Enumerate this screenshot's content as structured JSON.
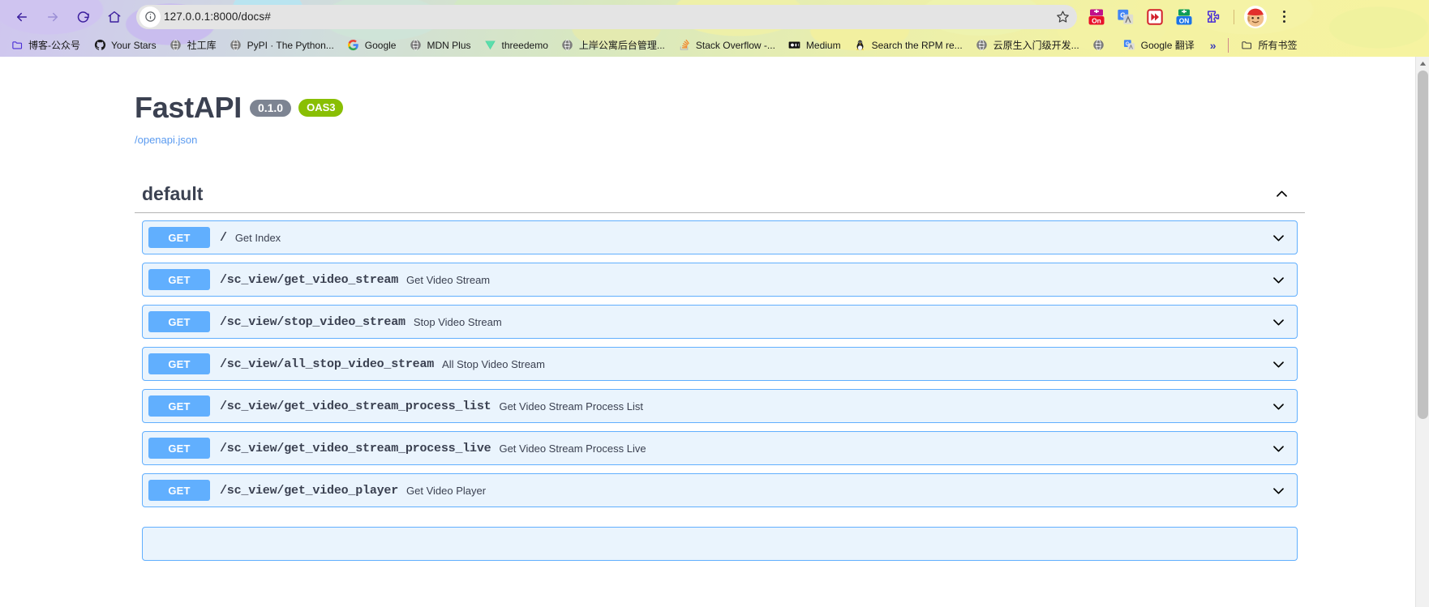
{
  "browser": {
    "nav": {
      "back_label": "Back",
      "forward_label": "Forward",
      "reload_label": "Reload",
      "home_label": "Home"
    },
    "omnibox": {
      "url": "127.0.0.1:8000/docs#",
      "info_icon": "site-info-icon",
      "bookmark_icon": "star-icon"
    },
    "extensions": [
      {
        "name": "adblock-on-extension",
        "label": "On"
      },
      {
        "name": "google-translate-extension",
        "label": "G"
      },
      {
        "name": "fast-forward-extension",
        "label": ""
      },
      {
        "name": "proxy-on-extension",
        "label": "ON"
      },
      {
        "name": "extensions-puzzle-icon",
        "label": ""
      }
    ],
    "profile": {
      "name": "profile-avatar"
    },
    "menu": {
      "name": "chrome-menu-kebab"
    },
    "bookmarks": [
      {
        "label": "博客-公众号",
        "icon": "folder-icon"
      },
      {
        "label": "Your Stars",
        "icon": "github-icon"
      },
      {
        "label": "社工库",
        "icon": "globe-icon"
      },
      {
        "label": "PyPI · The Python...",
        "icon": "globe-icon"
      },
      {
        "label": "Google",
        "icon": "google-icon"
      },
      {
        "label": "MDN Plus",
        "icon": "globe-icon"
      },
      {
        "label": "threedemo",
        "icon": "vite-icon"
      },
      {
        "label": "上岸公寓后台管理...",
        "icon": "globe-icon"
      },
      {
        "label": "Stack Overflow -...",
        "icon": "stackoverflow-icon"
      },
      {
        "label": "Medium",
        "icon": "medium-icon"
      },
      {
        "label": "Search the RPM re...",
        "icon": "linux-tux-icon"
      },
      {
        "label": "云原生入门级开发...",
        "icon": "globe-icon"
      },
      {
        "label": "Google 翻译",
        "icon": "google-translate-icon"
      }
    ],
    "bookmarks_overflow": "»",
    "all_bookmarks": {
      "label": "所有书签",
      "icon": "folder-icon"
    }
  },
  "swagger": {
    "title": "FastAPI",
    "version_badge": "0.1.0",
    "oas_badge": "OAS3",
    "spec_link": "/openapi.json",
    "tag": {
      "name": "default",
      "collapse_icon": "chevron-up-icon",
      "expanded": true
    },
    "operations": [
      {
        "method": "GET",
        "path": "/",
        "summary": "Get Index",
        "chevron": "chevron-down-icon"
      },
      {
        "method": "GET",
        "path": "/sc_view/get_video_stream",
        "summary": "Get Video Stream",
        "chevron": "chevron-down-icon"
      },
      {
        "method": "GET",
        "path": "/sc_view/stop_video_stream",
        "summary": "Stop Video Stream",
        "chevron": "chevron-down-icon"
      },
      {
        "method": "GET",
        "path": "/sc_view/all_stop_video_stream",
        "summary": "All Stop Video Stream",
        "chevron": "chevron-down-icon"
      },
      {
        "method": "GET",
        "path": "/sc_view/get_video_stream_process_list",
        "summary": "Get Video Stream Process List",
        "chevron": "chevron-down-icon"
      },
      {
        "method": "GET",
        "path": "/sc_view/get_video_stream_process_live",
        "summary": "Get Video Stream Process Live",
        "chevron": "chevron-down-icon"
      },
      {
        "method": "GET",
        "path": "/sc_view/get_video_player",
        "summary": "Get Video Player",
        "chevron": "chevron-down-icon"
      }
    ]
  },
  "colors": {
    "get_method": "#61affe",
    "get_row_bg": "#eaf4fd",
    "oas_badge": "#89bf04",
    "version_badge": "#7d8492",
    "link": "#5b9bf0",
    "heading": "#3b4151"
  },
  "scrollbar": {
    "name": "page-scrollbar",
    "position_percent": 0
  }
}
